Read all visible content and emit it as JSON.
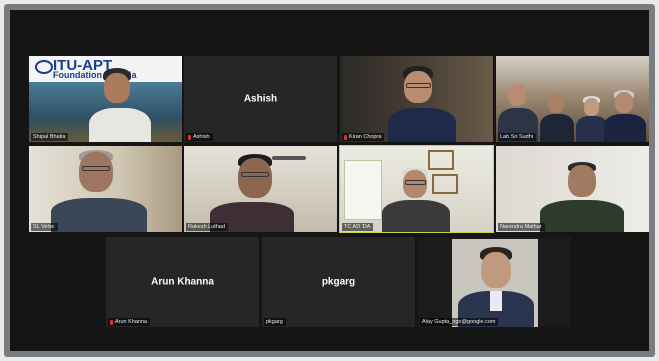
{
  "call": {
    "participants": [
      {
        "name": "Shipal Bhatia",
        "display": "Shipal Bhatia",
        "mic_muted": false,
        "has_video": true,
        "banner_line1": "ITU-APT",
        "banner_line2": "Foundation of India"
      },
      {
        "name": "Ashish",
        "display": "Ashish",
        "mic_muted": true,
        "has_video": false
      },
      {
        "name": "Kiran Chopra",
        "display": "Kiran Chopra",
        "mic_muted": true,
        "has_video": true
      },
      {
        "name": "Lab Sri Sudhi",
        "display": "Lab Sri Sudhi",
        "mic_muted": false,
        "has_video": true
      },
      {
        "name": "SL Vehic",
        "display": "SL Vehic",
        "mic_muted": false,
        "has_video": true
      },
      {
        "name": "Rakesh Luthad",
        "display": "Rakesh Luthad",
        "mic_muted": false,
        "has_video": true
      },
      {
        "name": "TC AD 'DA",
        "display": "TC AD 'DA",
        "mic_muted": false,
        "has_video": true,
        "speaking": true
      },
      {
        "name": "Narendra Mathur",
        "display": "Narendra Mathur",
        "mic_muted": false,
        "has_video": true
      },
      {
        "name": "Arun Khanna",
        "display": "Arun Khanna",
        "mic_muted": true,
        "has_video": false
      },
      {
        "name": "pkgarg",
        "display": "pkgarg",
        "mic_muted": false,
        "has_video": false
      },
      {
        "name": "Alay Gupta_ngo@google.com",
        "display": "Alay Gupta_ngo@google.com",
        "mic_muted": false,
        "has_video": true
      }
    ]
  },
  "colors": {
    "speaking_outline": "#c8d34a",
    "muted_mic": "#e03030",
    "background": "#151515"
  }
}
